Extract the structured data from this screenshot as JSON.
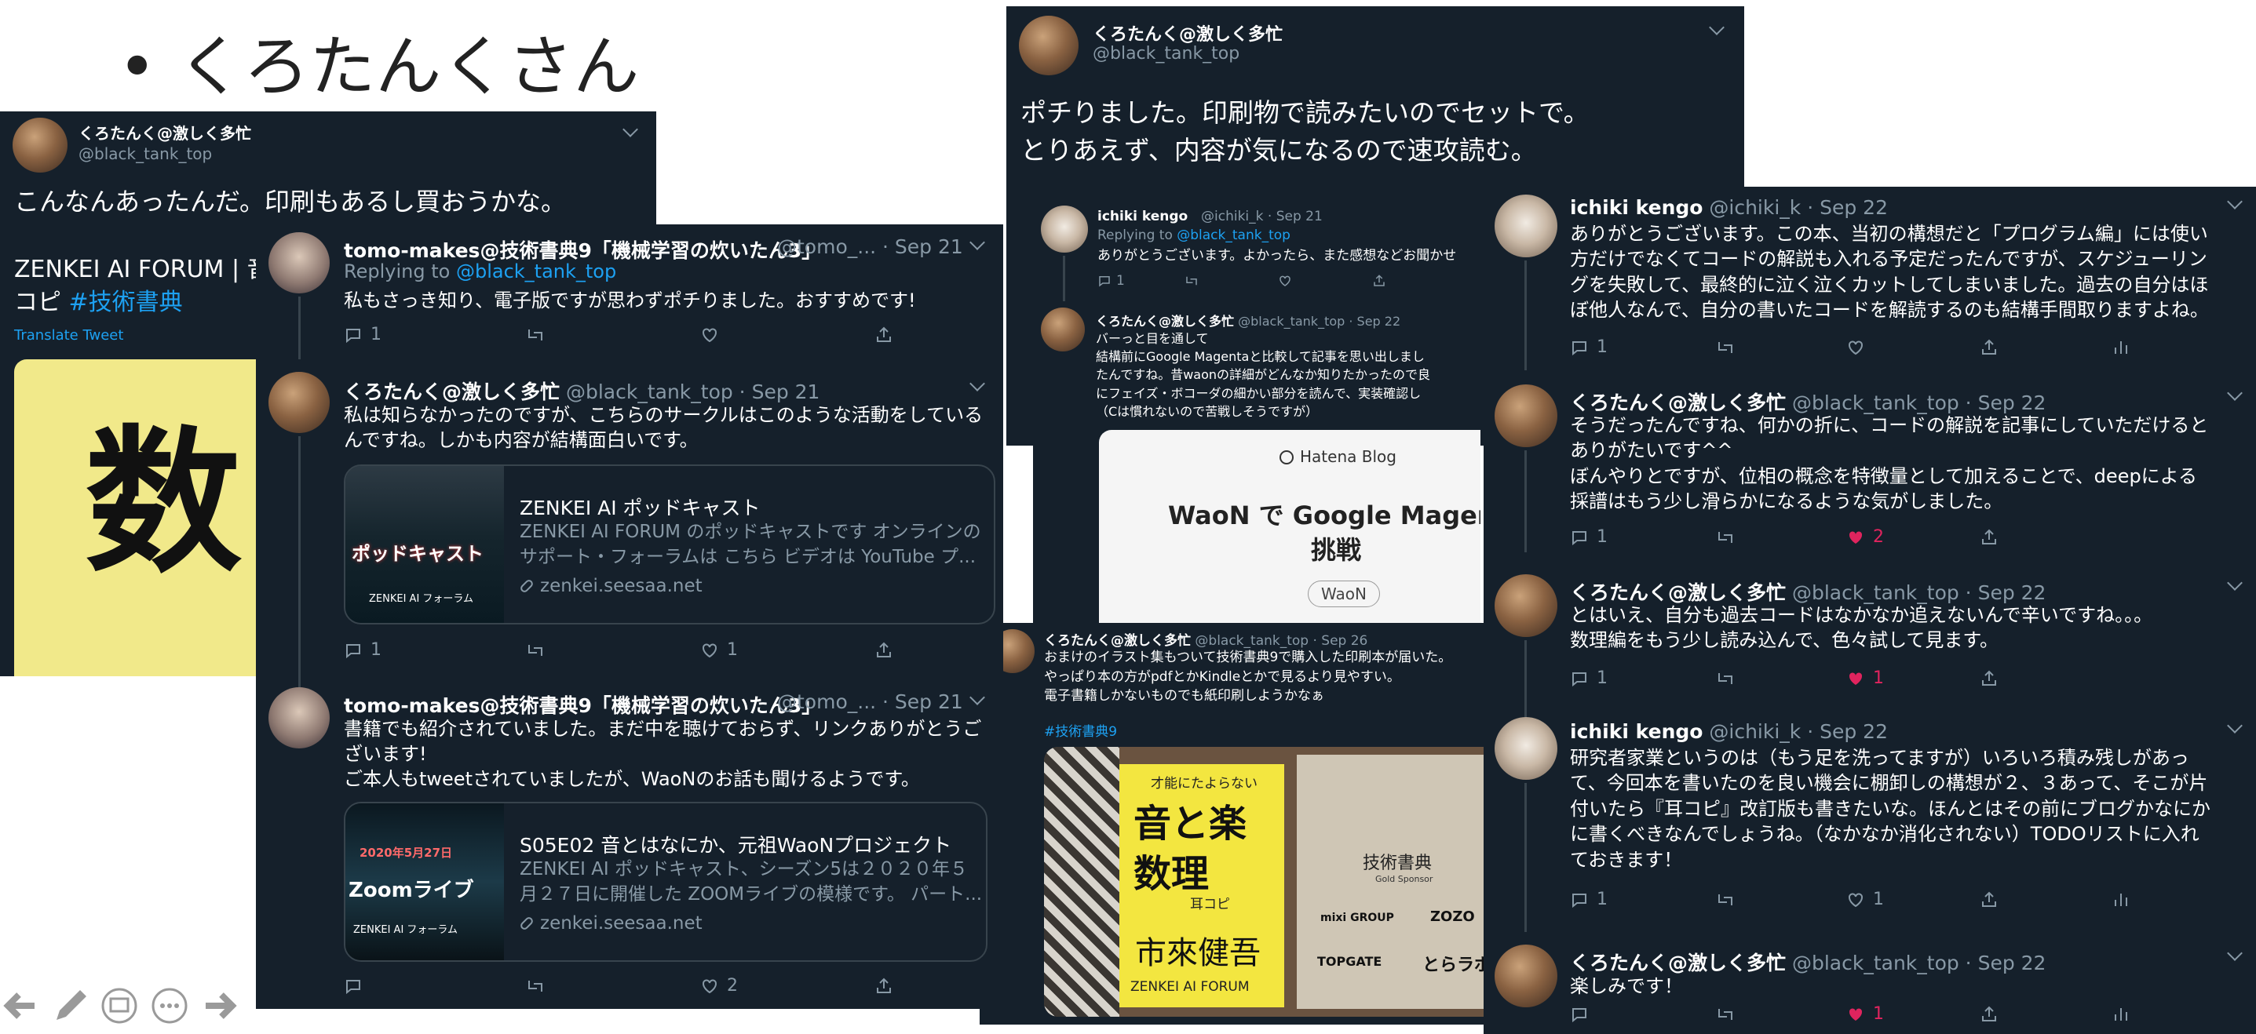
{
  "slide": {
    "bullet": "• くろたんくさん"
  },
  "p1": {
    "name": "くろたんく@激しく多忙",
    "handle": "@black_tank_top",
    "text": "こんなんあったんだ。印刷もあるし買おうかな。",
    "card_text1": "ZENKEI AI FORUM | 音",
    "card_text2": "コピ",
    "hashtag": "#技術書典",
    "translate": "Translate Tweet",
    "book_glyph": "数"
  },
  "p2": {
    "tweets": [
      {
        "name": "tomo-makes@技術書典9「機械学習の炊いたん3」",
        "meta": "@tomo_... · Sep 21",
        "replying": "Replying to",
        "reply_to": "@black_tank_top",
        "text": "私もさっき知り、電子版ですが思わずポチりました。おすすめです!",
        "reply_count": "1",
        "retweet_count": "",
        "like_count": ""
      },
      {
        "name": "くろたんく@激しく多忙",
        "meta": "@black_tank_top · Sep 21",
        "text1": "私は知らなかったのですが、こちらのサークルはこのような活動をしている",
        "text2": "んですね。しかも内容が結構面白いです。",
        "card": {
          "img_label": "ポッドキャスト",
          "img_sub": "ZENKEI AI フォーラム",
          "title": "ZENKEI AI ポッドキャスト",
          "desc1": "ZENKEI AI FORUM のポッドキャストです オンラインの",
          "desc2": "サポート・フォーラムは こちら ビデオは YouTube プ...",
          "link": "zenkei.seesaa.net"
        },
        "reply_count": "1",
        "like_count": "1"
      },
      {
        "name": "tomo-makes@技術書典9「機械学習の炊いたん3」",
        "meta": "@tomo_... · Sep 21",
        "text1": "書籍でも紹介されていました。まだ中を聴けておらず、リンクありがとうご",
        "text2": "ざいます!",
        "text3": "ご本人もtweetされていましたが、WaoNのお話も聞けるようです。",
        "card": {
          "img_label": "Zoomライブ",
          "img_date": "2020年5月27日",
          "img_sub": "ZENKEI AI フォーラム",
          "title": "S05E02 音とはなにか、元祖WaoNプロジェクト",
          "desc1": "ZENKEI AI ポッドキャスト、シーズン5は２０２０年５",
          "desc2": "月２７日に開催した ZOOMライブの模様です。 パート...",
          "link": "zenkei.seesaa.net"
        },
        "reply_count": "",
        "like_count": "2"
      }
    ]
  },
  "p3": {
    "name": "くろたんく@激しく多忙",
    "handle": "@black_tank_top",
    "text1": "ポチりました。印刷物で読みたいのでセットで。",
    "text2": "とりあえず、内容が気になるので速攻読む。",
    "reply": {
      "name": "ichiki kengo",
      "meta": "@ichiki_k · Sep 21",
      "replying": "Replying to",
      "reply_to": "@black_tank_top",
      "text": "ありがとうございます。よかったら、また感想などお聞かせ",
      "reply_count": "1"
    }
  },
  "p4": {
    "name": "くろたんく@激しく多忙",
    "meta": "@black_tank_top · Sep 22",
    "lines": [
      "バーっと目を通して",
      "結構前にGoogle Magentaと比較して記事を思い出しまし",
      "たんですね。昔waonの詳細がどんなか知りたかったので良",
      "にフェイズ・ボコーダの細かい部分を読んで、実装確認し",
      "（Cは慣れないので苦戦しそうですが）"
    ],
    "card": {
      "brand": "Hatena Blog",
      "title1": "WaoN で Google Magenta",
      "title2": "挑戦",
      "tag": "WaoN"
    }
  },
  "p5": {
    "name": "くろたんく@激しく多忙",
    "meta": "@black_tank_top · Sep 26",
    "lines": [
      "おまけのイラスト集もついて技術書典9で購入した印刷本が届いた。",
      "やっぱり本の方がpdfとかKindleとかで見るより見やすい。",
      "電子書籍しかないものでも紙印刷しようかなぁ"
    ],
    "hashtag": "#技術書典9",
    "book": {
      "tagline": "才能にたよらない",
      "title1": "音と楽",
      "title2": "数理",
      "subtitle": "耳コピ",
      "author": "市來健吾",
      "publisher": "ZENKEI AI FORUM"
    },
    "box": {
      "title": "技術書典",
      "sponsor": "Gold Sponsor",
      "logos": [
        "mixi GROUP",
        "ZOZO",
        "TOPGATE",
        "とらラボ!"
      ]
    }
  },
  "p6": {
    "tweets": [
      {
        "name": "ichiki kengo",
        "meta": "@ichiki_k · Sep 22",
        "lines": [
          "ありがとうございます。この本、当初の構想だと「プログラム編」には使い",
          "方だけでなくてコードの解説も入れる予定だったんですが、スケジューリン",
          "グを失敗して、最終的に泣く泣くカットしてしまいました。過去の自分はほ",
          "ぼ他人なんで、自分の書いたコードを解読するのも結構手間取りますよね。"
        ],
        "reply_count": "1",
        "like_count": ""
      },
      {
        "name": "くろたんく@激しく多忙",
        "meta": "@black_tank_top · Sep 22",
        "lines": [
          "そうだったんですね、何かの折に、コードの解説を記事にしていただけると",
          "ありがたいです^^",
          "ぼんやりとですが、位相の概念を特徴量として加えることで、deepによる",
          "採譜はもう少し滑らかになるような気がしました。"
        ],
        "reply_count": "1",
        "like_count": "2"
      },
      {
        "name": "くろたんく@激しく多忙",
        "meta": "@black_tank_top · Sep 22",
        "lines": [
          "とはいえ、自分も過去コードはなかなか追えないんで辛いですね。。。",
          "数理編をもう少し読み込んで、色々試して見ます。"
        ],
        "reply_count": "1",
        "like_count": "1"
      },
      {
        "name": "ichiki kengo",
        "meta": "@ichiki_k · Sep 22",
        "lines": [
          "研究者家業というのは（もう足を洗ってますが）いろいろ積み残しがあっ",
          "て、今回本を書いたのを良い機会に棚卸しの構想が２、３あって、そこが片",
          "付いたら『耳コピ』改訂版も書きたいな。ほんとはその前にブログかなにか",
          "に書くべきなんでしょうね。（なかなか消化されない）TODOリストに入れ",
          "ておきます！"
        ],
        "reply_count": "1",
        "like_count": "1"
      },
      {
        "name": "くろたんく@激しく多忙",
        "meta": "@black_tank_top · Sep 22",
        "lines": [
          "楽しみです！"
        ],
        "reply_count": "",
        "like_count": "1"
      }
    ]
  },
  "colors": {
    "panel_bg": "#15202b",
    "link": "#1da1f2",
    "muted": "#8899a6",
    "like": "#e0245e",
    "border": "#38444d"
  }
}
